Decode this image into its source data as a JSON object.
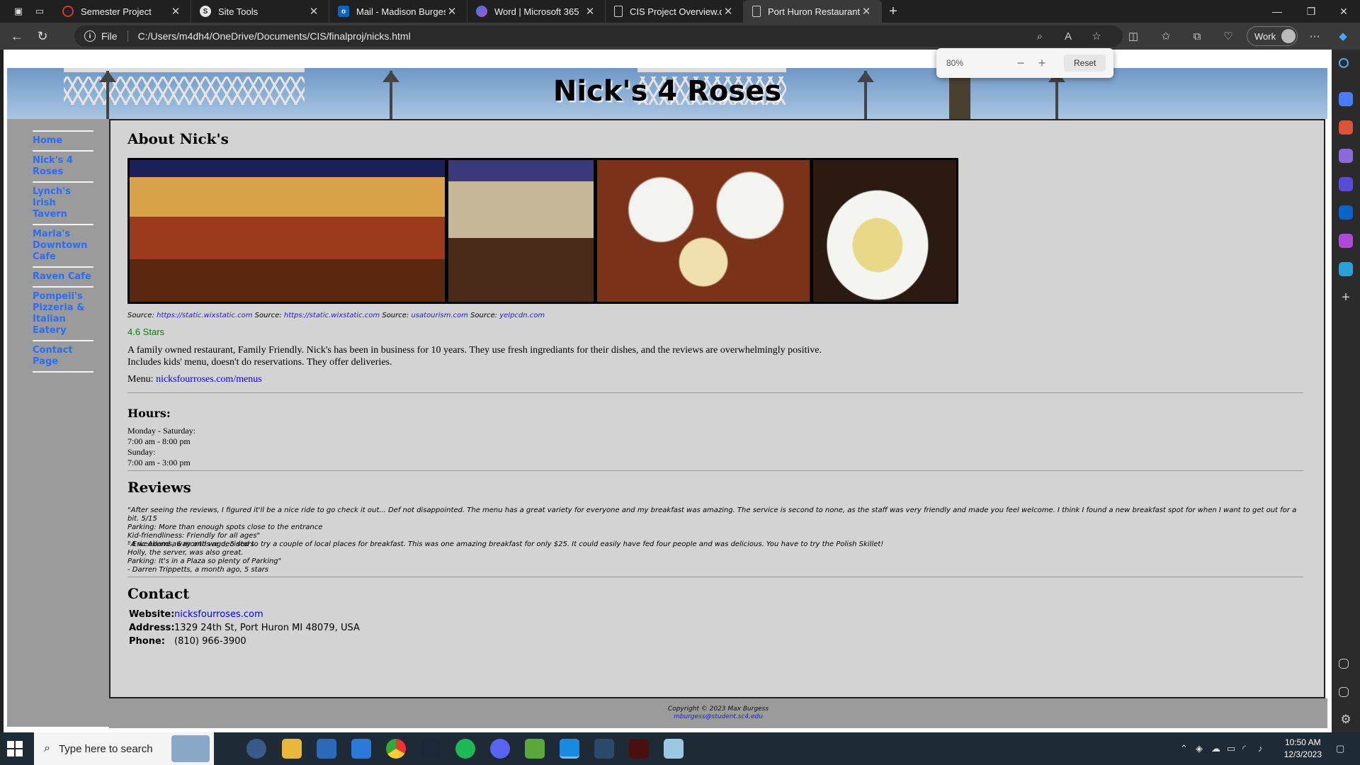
{
  "browser": {
    "tabs": [
      {
        "title": "Semester Project",
        "icon": "circle-arrow-icon",
        "color": "#d9342b"
      },
      {
        "title": "Site Tools",
        "icon": "site-s-icon",
        "color": "#e6e6e6"
      },
      {
        "title": "Mail - Madison Burgess - Outlook",
        "icon": "outlook-icon",
        "color": "#0a64c8"
      },
      {
        "title": "Word | Microsoft 365",
        "icon": "m365-icon",
        "color": "#7a4fd8"
      },
      {
        "title": "CIS Project Overview.docx",
        "icon": "document-icon",
        "color": "#cccccc"
      },
      {
        "title": "Port Huron Restaurants - Nick's",
        "icon": "document-icon",
        "color": "#cccccc"
      }
    ],
    "address_label": "File",
    "url": "C:/Users/m4dh4/OneDrive/Documents/CIS/finalproj/nicks.html",
    "profile": "Work",
    "zoom": {
      "value": "80%",
      "reset_label": "Reset"
    }
  },
  "page": {
    "site_title": "Nick's 4 Roses",
    "nav": [
      "Home",
      "Nick's 4 Roses",
      "Lynch's Irish Tavern",
      "Maria's Downtown Cafe",
      "Raven Cafe",
      "Pompeii's Pizzeria & Italian Eatery",
      "Contact Page"
    ],
    "about": {
      "heading": "About Nick's",
      "sources": [
        {
          "label": "Source:",
          "link": "https://static.wixstatic.com"
        },
        {
          "label": "Source:",
          "link": "https://static.wixstatic.com"
        },
        {
          "label": "Source:",
          "link": "usatourism.com"
        },
        {
          "label": "Source:",
          "link": "yelpcdn.com"
        }
      ],
      "rating": "4.6 Stars",
      "description_1": "A family owned restaurant, Family Friendly. Nick's has been in business for 10 years. They use fresh ingrediants for their dishes, and the reviews are overwhelmingly positive.",
      "description_2": "Includes kids' menu, doesn't do reservations. They offer deliveries.",
      "menu_label": "Menu:",
      "menu_link": "nicksfourroses.com/menus"
    },
    "hours": {
      "heading": "Hours:",
      "lines": [
        "Monday - Saturday:",
        "7:00 am - 8:00 pm",
        "Sunday:",
        "7:00 am - 3:00 pm"
      ]
    },
    "reviews": {
      "heading": "Reviews",
      "items": [
        {
          "lines": [
            "\"After seeing the reviews, I figured it'll be a nice ride to go check it out... Def not disappointed. The menu has a great variety for everyone and my breakfast was amazing. The service is second to none, as the staff was very friendly and made you feel welcome. I think I found a new breakfast spot for when I want to get out for a bit. 5/15",
            "Parking: More than enough spots close to the entrance",
            "Kid-friendliness: Friendly for all ages\"",
            "- Eric Adams, 6 months ago, 5 stars"
          ]
        },
        {
          "lines": [
            "\"A weekend away and we decided to try a couple of local places for breakfast. This was one amazing breakfast for only $25. It could easily have fed four people and was delicious. You have to try the Polish Skillet!",
            "Holly, the server, was also great.",
            "Parking: It's in a Plaza so plenty of Parking\"",
            "- Darren Trippetts, a month ago, 5 stars"
          ]
        }
      ]
    },
    "contact": {
      "heading": "Contact",
      "website_label": "Website:",
      "website": "nicksfourroses.com",
      "address_label": "Address:",
      "address": "1329 24th St, Port Huron MI 48079, USA",
      "phone_label": "Phone:",
      "phone": "(810) 966-3900"
    },
    "footer": {
      "copyright": "Copyright © 2023 Max Burgess",
      "email": "mburgess@student.sc4.edu"
    }
  },
  "taskbar": {
    "search_placeholder": "Type here to search",
    "time": "10:50 AM",
    "date": "12/3/2023"
  }
}
